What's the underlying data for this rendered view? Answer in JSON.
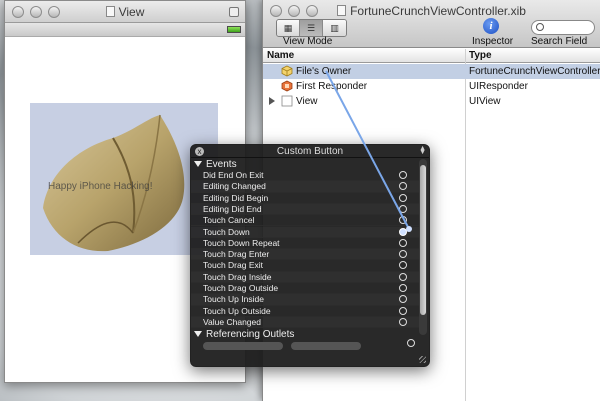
{
  "view_window": {
    "title": "View",
    "image_label": "Happy iPhone Hacking!"
  },
  "doc_window": {
    "title": "FortuneCrunchViewController.xib",
    "toolbar": {
      "view_mode_label": "View Mode",
      "inspector_label": "Inspector",
      "search_label": "Search Field",
      "info_glyph": "i"
    },
    "table": {
      "headers": {
        "name": "Name",
        "type": "Type"
      },
      "rows": [
        {
          "name": "File's Owner",
          "type": "FortuneCrunchViewController",
          "icon": "cube-icon"
        },
        {
          "name": "First Responder",
          "type": "UIResponder",
          "icon": "responder-icon"
        },
        {
          "name": "View",
          "type": "UIView",
          "icon": "view-icon"
        }
      ]
    }
  },
  "hud": {
    "title": "Custom Button",
    "close_glyph": "x",
    "events_section": "Events",
    "events": [
      {
        "label": "Did End On Exit",
        "connected": false
      },
      {
        "label": "Editing Changed",
        "connected": false
      },
      {
        "label": "Editing Did Begin",
        "connected": false
      },
      {
        "label": "Editing Did End",
        "connected": false
      },
      {
        "label": "Touch Cancel",
        "connected": false
      },
      {
        "label": "Touch Down",
        "connected": true
      },
      {
        "label": "Touch Down Repeat",
        "connected": false
      },
      {
        "label": "Touch Drag Enter",
        "connected": false
      },
      {
        "label": "Touch Drag Exit",
        "connected": false
      },
      {
        "label": "Touch Drag Inside",
        "connected": false
      },
      {
        "label": "Touch Drag Outside",
        "connected": false
      },
      {
        "label": "Touch Up Inside",
        "connected": false
      },
      {
        "label": "Touch Up Outside",
        "connected": false
      },
      {
        "label": "Value Changed",
        "connected": false
      }
    ],
    "outlets_section": "Referencing Outlets"
  },
  "colors": {
    "selection": "#c2cfe4",
    "hud_bg": "#1c1c1c",
    "connection_line": "#7aa6e8"
  }
}
